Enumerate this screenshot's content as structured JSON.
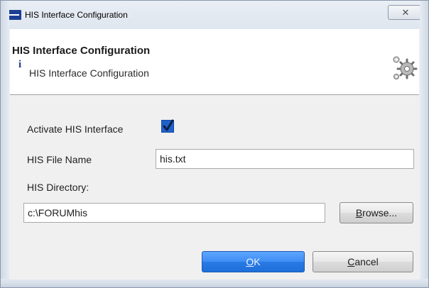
{
  "window": {
    "title": "HIS Interface Configuration",
    "close_glyph": "✕"
  },
  "header": {
    "title": "HIS Interface Configuration",
    "subtitle": "HIS Interface Configuration",
    "info_glyph": "i"
  },
  "form": {
    "activate_label": "Activate HIS Interface",
    "activate_checked": true,
    "file_name_label": "HIS File Name",
    "file_name_value": "his.txt",
    "directory_label": "HIS Directory:",
    "directory_value": "c:\\FORUMhis"
  },
  "buttons": {
    "browse_first": "B",
    "browse_rest": "rowse...",
    "ok_first": "O",
    "ok_rest": "K",
    "cancel_first": "C",
    "cancel_rest": "ancel"
  },
  "colors": {
    "accent": "#1f61c9",
    "ok_button": "#3d8df3",
    "info_icon": "#1f3b8f"
  }
}
